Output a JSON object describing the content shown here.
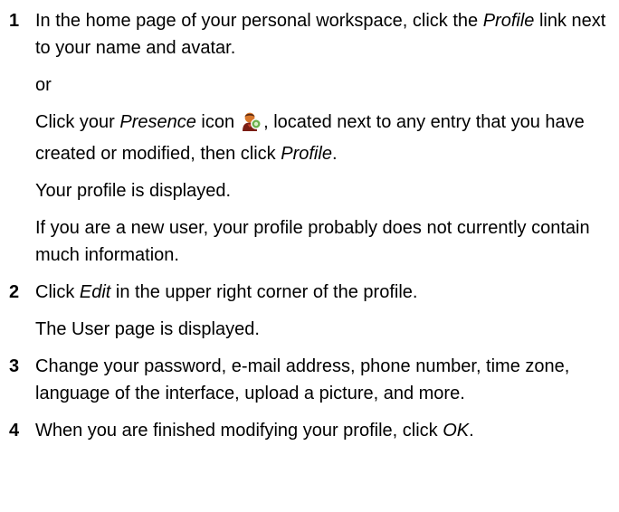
{
  "steps": [
    {
      "number": "1",
      "p1": {
        "a": "In the home page of your personal workspace, click the ",
        "em": "Profile",
        "b": " link next to your name and avatar."
      },
      "or": "or",
      "p3": {
        "a": "Click your ",
        "em1": "Presence",
        "b": " icon",
        "c": ", located next to any entry that you have created or modified, then click ",
        "em2": "Profile",
        "d": "."
      },
      "p4": "Your profile is displayed.",
      "p5": "If you are a new user, your profile probably does not currently contain much information."
    },
    {
      "number": "2",
      "p1": {
        "a": "Click ",
        "em": "Edit",
        "b": " in the upper right corner of the profile."
      },
      "p2": "The User page is displayed."
    },
    {
      "number": "3",
      "p1": "Change your password, e-mail address, phone number, time zone, language of the interface, upload a picture, and more."
    },
    {
      "number": "4",
      "p1": {
        "a": "When you are finished modifying your profile, click ",
        "em": "OK",
        "b": "."
      }
    }
  ],
  "icons": {
    "presence": "presence-user-icon"
  },
  "colors": {
    "text": "#000000",
    "icon_head": "#d9772b",
    "icon_body": "#7a1e14",
    "icon_badge": "#6ab04c"
  }
}
